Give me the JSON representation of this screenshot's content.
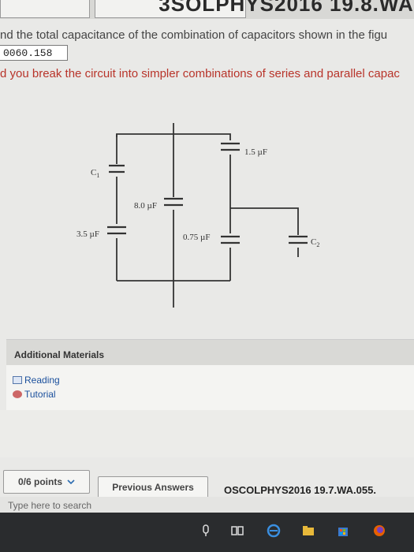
{
  "page": {
    "corner_title": "3SOLPHYS2016 19.8.WA.",
    "question": "nd the total capacitance of the combination of capacitors shown in the figu",
    "answer_value": "0060.158",
    "hint": "d you break the circuit into simpler combinations of series and parallel capac"
  },
  "circuit": {
    "labels": {
      "c1": "C",
      "c1_sub": "1",
      "c2": "C",
      "c2_sub": "2",
      "cap_1_5": "1.5 µF",
      "cap_8_0": "8.0 µF",
      "cap_3_5": "3.5 µF",
      "cap_0_75": "0.75 µF"
    }
  },
  "materials": {
    "title": "Additional Materials",
    "links": [
      "Reading",
      "Tutorial"
    ]
  },
  "footer": {
    "points_label": "0/6 points",
    "previous_label": "Previous Answers",
    "reference": "OSCOLPHYS2016 19.7.WA.055."
  },
  "taskbar": {
    "search_placeholder": "Type here to search"
  },
  "colors": {
    "hint": "#b8342a",
    "link": "#1a4f9c",
    "taskbar": "#2a2c2e"
  }
}
